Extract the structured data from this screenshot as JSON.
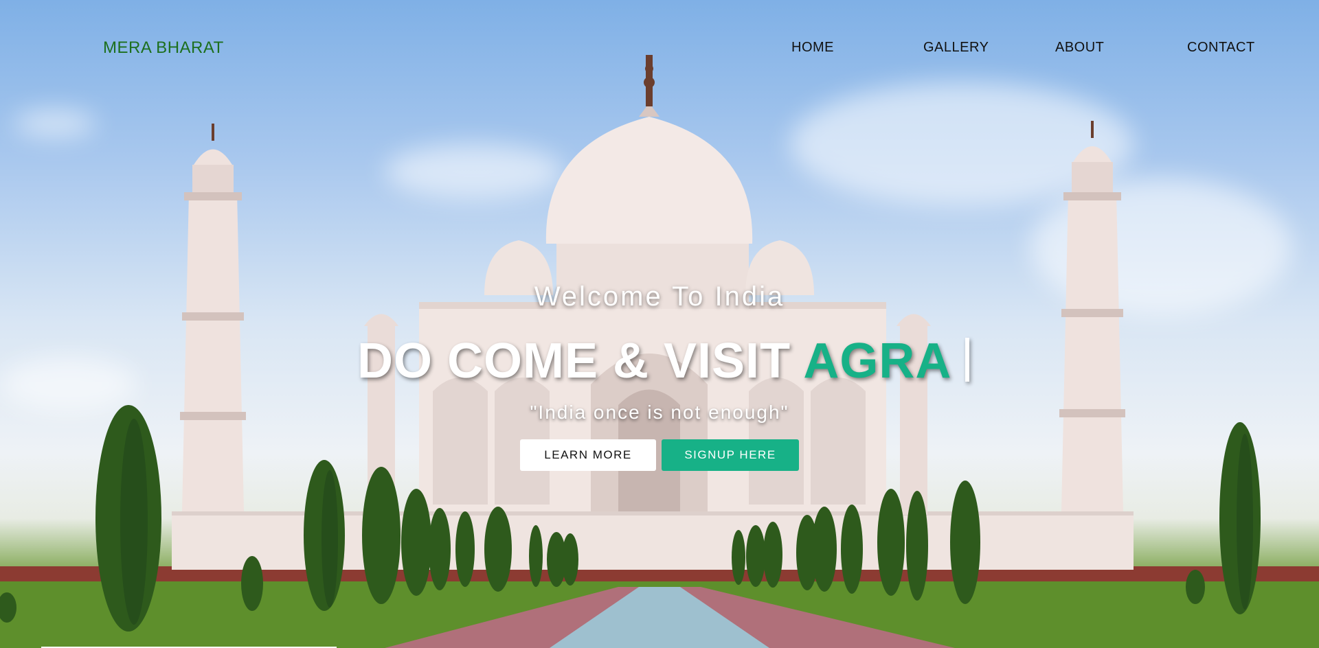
{
  "nav": {
    "brand": "MERA BHARAT",
    "links": [
      "HOME",
      "GALLERY",
      "ABOUT",
      "CONTACT"
    ]
  },
  "hero": {
    "welcome": "Welcome To India",
    "headline_prefix": "DO COME & VISIT ",
    "headline_accent": "AGRA",
    "tagline": "\"India once is not enough\"",
    "buttons": {
      "learn_more": "LEARN MORE",
      "signup": "SIGNUP HERE"
    }
  },
  "colors": {
    "accent": "#17b187",
    "brand": "#1d6f1d"
  },
  "background_image": "taj-mahal-photo"
}
